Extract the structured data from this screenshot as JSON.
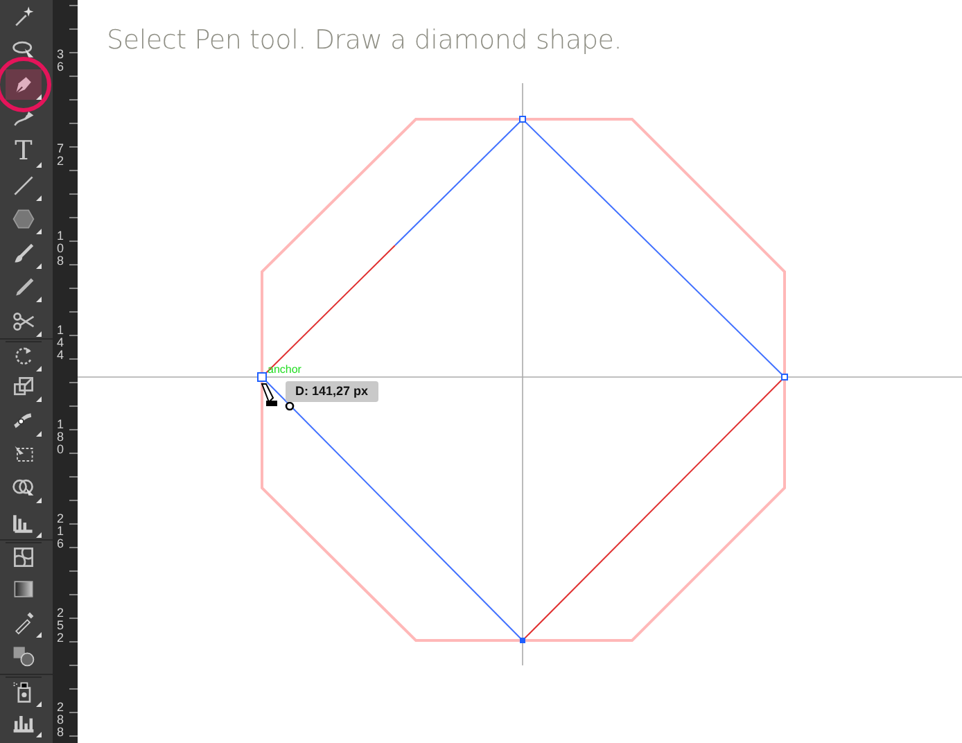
{
  "instruction": "Select Pen tool. Draw a diamond shape.",
  "tools": [
    {
      "kind": "wand",
      "selected": false,
      "flyout": false,
      "divider_before": false
    },
    {
      "kind": "lasso",
      "selected": false,
      "flyout": false,
      "divider_before": false
    },
    {
      "kind": "pen",
      "selected": true,
      "flyout": true,
      "divider_before": false
    },
    {
      "kind": "curvature",
      "selected": false,
      "flyout": false,
      "divider_before": false
    },
    {
      "kind": "type",
      "glyph": "T",
      "selected": false,
      "flyout": true,
      "divider_before": false
    },
    {
      "kind": "line",
      "selected": false,
      "flyout": true,
      "divider_before": false
    },
    {
      "kind": "polygon",
      "selected": false,
      "flyout": true,
      "divider_before": false
    },
    {
      "kind": "brush",
      "selected": false,
      "flyout": true,
      "divider_before": false
    },
    {
      "kind": "pencil",
      "selected": false,
      "flyout": true,
      "divider_before": false
    },
    {
      "kind": "scissors",
      "selected": false,
      "flyout": true,
      "divider_before": false
    },
    {
      "kind": "rotate",
      "selected": false,
      "flyout": true,
      "divider_before": true
    },
    {
      "kind": "scale",
      "selected": false,
      "flyout": true,
      "divider_before": false
    },
    {
      "kind": "puppet",
      "selected": false,
      "flyout": true,
      "divider_before": false
    },
    {
      "kind": "transform",
      "selected": false,
      "flyout": false,
      "divider_before": false
    },
    {
      "kind": "builder",
      "selected": false,
      "flyout": true,
      "divider_before": false
    },
    {
      "kind": "chart",
      "selected": false,
      "flyout": true,
      "divider_before": false
    },
    {
      "kind": "mesh",
      "selected": false,
      "flyout": false,
      "divider_before": true
    },
    {
      "kind": "gradient",
      "selected": false,
      "flyout": false,
      "divider_before": false
    },
    {
      "kind": "eyedropper",
      "selected": false,
      "flyout": true,
      "divider_before": false
    },
    {
      "kind": "blend",
      "selected": false,
      "flyout": false,
      "divider_before": false
    },
    {
      "kind": "sprayer",
      "selected": false,
      "flyout": true,
      "divider_before": true
    },
    {
      "kind": "column",
      "selected": false,
      "flyout": true,
      "divider_before": false
    }
  ],
  "ruler": [
    "36",
    "72",
    "108",
    "144",
    "180",
    "216",
    "252",
    "288"
  ],
  "canvas": {
    "anchor_label": "anchor",
    "tooltip": "D: 141,27 px"
  }
}
